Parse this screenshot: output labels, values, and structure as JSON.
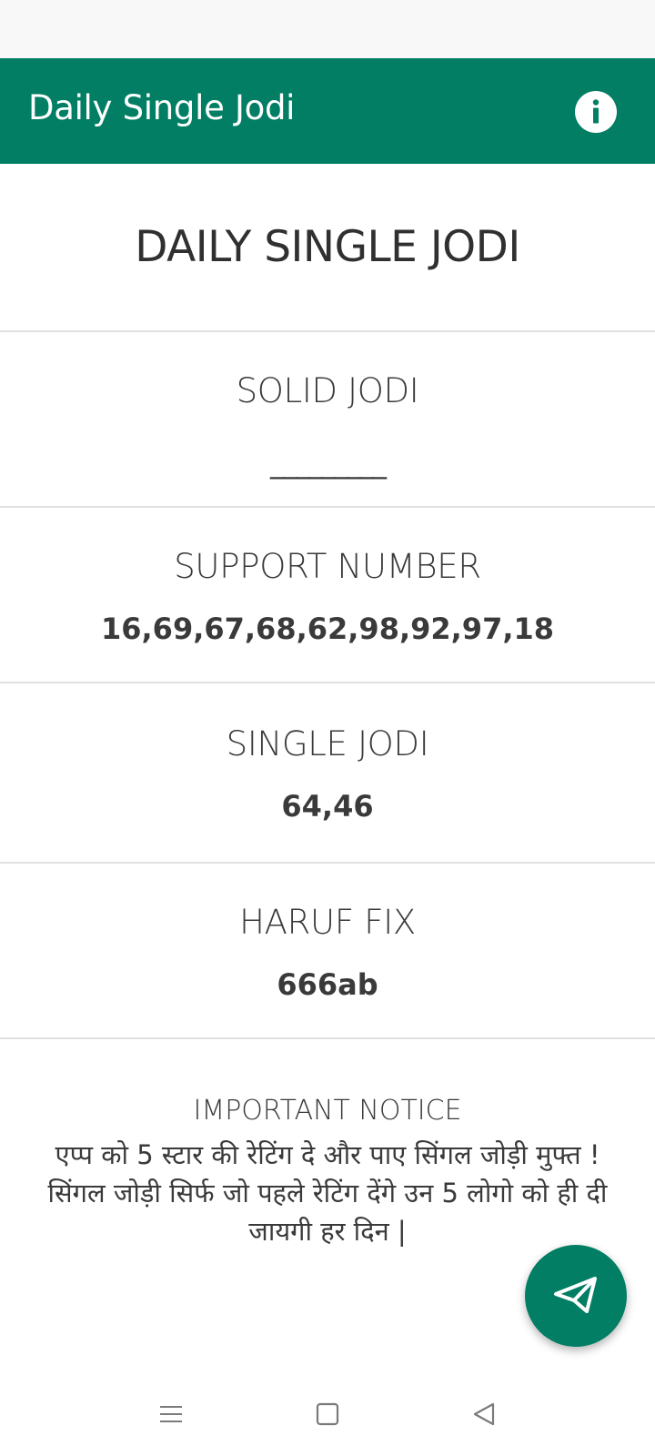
{
  "app_bar": {
    "title": "Daily Single Jodi",
    "info_icon": "info-icon"
  },
  "main": {
    "heading": "DAILY SINGLE JODI",
    "sections": [
      {
        "title": "SOLID JODI",
        "value": "_________"
      },
      {
        "title": "SUPPORT NUMBER",
        "value": "16,69,67,68,62,98,92,97,18"
      },
      {
        "title": "SINGLE JODI",
        "value": "64,46"
      },
      {
        "title": "HARUF FIX",
        "value": "666ab"
      }
    ],
    "notice": {
      "title": "IMPORTANT NOTICE",
      "body": "एप्प को 5 स्टार की रेटिंग दे और पाए सिंगल जोड़ी मुफ्त ! सिंगल जोड़ी सिर्फ जो पहले रेटिंग देंगे उन 5 लोगो को ही दी जायगी हर दिन |"
    }
  },
  "fab": {
    "icon": "send-icon"
  },
  "nav_bar": {
    "items": [
      "menu-icon",
      "home-square-icon",
      "back-triangle-icon"
    ]
  },
  "colors": {
    "primary": "#017e63",
    "text": "#3a3a3a",
    "divider": "#e0e0e0",
    "status_bar": "#f8f8f8"
  }
}
